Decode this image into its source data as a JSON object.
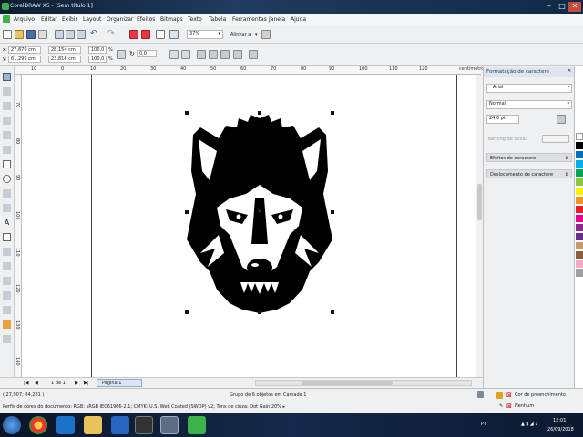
{
  "window": {
    "title": "CorelDRAW X5 - [Sem título 1]",
    "buttons": [
      "–",
      "□",
      "✕"
    ]
  },
  "menu": [
    "Arquivo",
    "Editar",
    "Exibir",
    "Layout",
    "Organizar",
    "Efeitos",
    "Bitmaps",
    "Texto",
    "Tabela",
    "Ferramentas",
    "Janela",
    "Ajuda"
  ],
  "toolbar": {
    "zoom": "37%",
    "snap": "Alinhar a"
  },
  "property_bar": {
    "x": "27,879 cm",
    "y": "61,299 cm",
    "width": "28,154 cm",
    "height": "23,816 cm",
    "scale_w": "100,0",
    "scale_h": "100,0",
    "scale_unit": "%",
    "angle": "0,0"
  },
  "rulers": {
    "unit": "centímetros",
    "top_ticks": [
      "10",
      "0",
      "10",
      "20",
      "30",
      "40",
      "50",
      "60",
      "70",
      "80",
      "90",
      "100",
      "110",
      "120"
    ],
    "left_ticks": [
      "70",
      "80",
      "90",
      "100",
      "110",
      "120",
      "130",
      "140"
    ]
  },
  "page_nav": {
    "first": "|◀",
    "prev": "◀",
    "position": "1 de 1",
    "next": "▶",
    "last": "▶|",
    "page_tab": "Página 1"
  },
  "docker": {
    "title": "Formatação de caractere",
    "font": "Arial",
    "style": "Normal",
    "size": "24,0 pt",
    "kerning_label": "Kerning de faixa:",
    "sections": [
      "Efeitos de caractere",
      "Deslocamento de caractere"
    ]
  },
  "palette_colors": [
    "#ffffff",
    "#000000",
    "#0072bc",
    "#00aeef",
    "#00a651",
    "#8dc63f",
    "#fff200",
    "#f7941d",
    "#ed1c24",
    "#ec008c",
    "#92278f",
    "#662d91",
    "#c69c6d",
    "#8b5e3c",
    "#f5a8c6",
    "#a0a0a0"
  ],
  "status": {
    "coords": "( 27,907; 84,281 )",
    "selection": "Grupo de 6 objetos em Camada 1",
    "profile": "Perfis de cores do documento: RGB: sRGB IEC61966-2.1; CMYK: U.S. Web Coated (SWOP) v2; Tons de cinza: Dot Gain 20% ▸",
    "fill_label": "Cor de preenchimento",
    "outline_label": "Nenhum"
  },
  "taskbar": {
    "time": "12:01",
    "date": "26/09/2018",
    "lang": "PT"
  }
}
